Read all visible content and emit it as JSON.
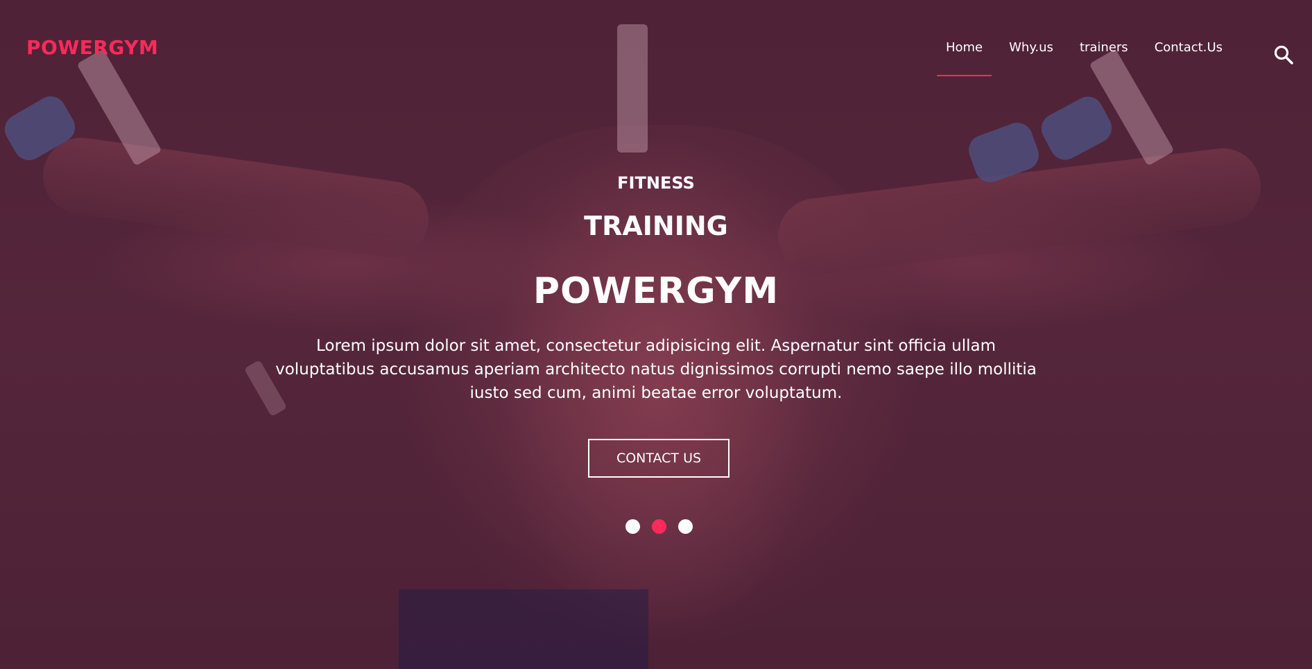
{
  "brand": {
    "name": "POWERGYM",
    "accent_color": "#ff2a5a"
  },
  "nav": {
    "items": [
      {
        "label": "Home",
        "active": true
      },
      {
        "label": "Why.us",
        "active": false
      },
      {
        "label": "trainers",
        "active": false
      },
      {
        "label": "Contact.Us",
        "active": false
      }
    ],
    "search_icon": "search-icon"
  },
  "hero": {
    "kicker": "FITNESS",
    "subtitle": "TRAINING",
    "headline": "POWERGYM",
    "description": "Lorem ipsum dolor sit amet, consectetur adipisicing elit. Aspernatur sint officia ullam voluptatibus accusamus aperiam architecto natus dignissimos corrupti nemo saepe illo mollitia iusto sed cum, animi beatae error voluptatum.",
    "cta_label": "CONTACT US",
    "overlay_color": "#52243a"
  },
  "carousel": {
    "slides": 3,
    "active_index": 1
  }
}
